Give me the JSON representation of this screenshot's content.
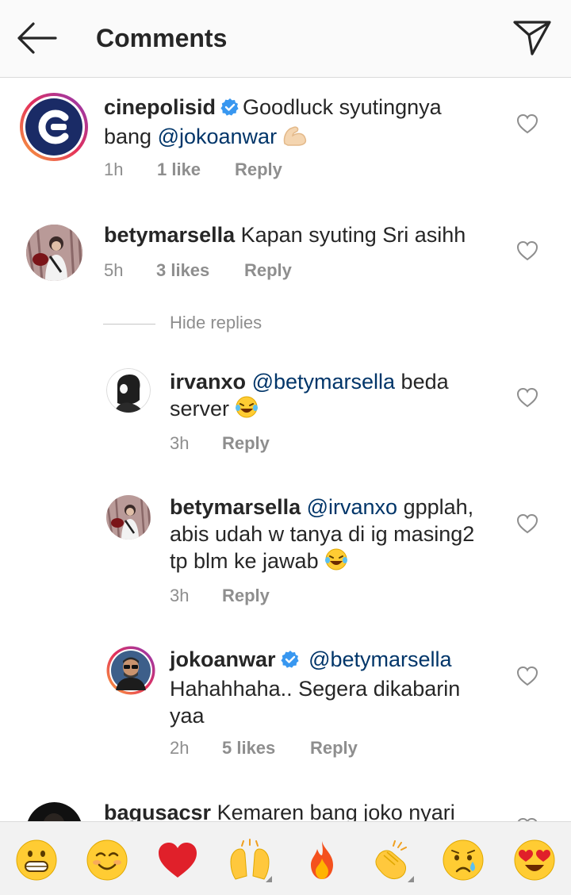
{
  "header": {
    "title": "Comments",
    "back_icon": "arrow-left-icon",
    "send_icon": "paper-plane-icon"
  },
  "colors": {
    "mention": "#003569",
    "meta": "#8e8e8e",
    "verified": "#3897f0",
    "header_bg": "#fafafa",
    "emoji_bar_bg": "#f2f2f2"
  },
  "comments": [
    {
      "username": "cinepolisid",
      "verified": true,
      "line1": "Goodluck syutingnya",
      "line2_prefix": "bang ",
      "mention": "@jokoanwar",
      "emoji": "flexed-biceps-emoji",
      "time": "1h",
      "likes": "1 like",
      "reply": "Reply"
    },
    {
      "username": "betymarsella",
      "text": "Kapan syuting Sri asihh",
      "time": "5h",
      "likes": "3 likes",
      "reply": "Reply"
    }
  ],
  "hide_replies": "Hide replies",
  "replies": [
    {
      "username": "irvanxo",
      "mention": "@betymarsella",
      "line1_suffix": " beda",
      "line2": "server",
      "emoji": "rofl-emoji",
      "time": "3h",
      "reply": "Reply"
    },
    {
      "username": "betymarsella",
      "mention": "@irvanxo",
      "line1_suffix": " gpplah,",
      "line2": "abis udah w tanya di ig masing2",
      "line3": "tp blm ke jawab",
      "emoji": "rofl-emoji",
      "time": "3h",
      "reply": "Reply"
    },
    {
      "username": "jokoanwar",
      "verified": true,
      "mention": "@betymarsella",
      "line2": "Hahahhaha.. Segera dikabarin",
      "line3": "yaa",
      "time": "2h",
      "likes": "5 likes",
      "reply": "Reply"
    }
  ],
  "partial_comment": {
    "username": "bagusacsr",
    "text": "Kemaren bang joko nyari"
  },
  "emoji_bar": [
    "grinning-face-emoji",
    "smiling-face-emoji",
    "red-heart-emoji",
    "raising-hands-emoji",
    "fire-emoji",
    "clapping-hands-emoji",
    "crying-face-emoji",
    "heart-eyes-emoji"
  ]
}
